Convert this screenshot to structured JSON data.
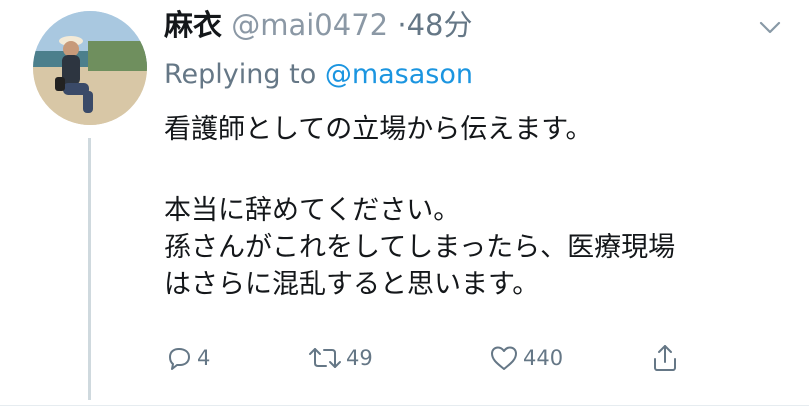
{
  "tweet": {
    "display_name": "麻衣",
    "handle": "@mai0472",
    "separator": "·",
    "time": "48分",
    "reply_prefix": "Replying to",
    "reply_to": "@masason",
    "lines": [
      "看護師としての立場から伝えます。",
      "本当に辞めてください。",
      "孫さんがこれをしてしまったら、医療現場",
      "はさらに混乱すると思います。"
    ]
  },
  "actions": {
    "reply_count": "4",
    "retweet_count": "49",
    "like_count": "440",
    "share_count": ""
  },
  "icons": {
    "avatar": "avatar-photo",
    "menu": "chevron-down-icon",
    "reply": "reply-icon",
    "retweet": "retweet-icon",
    "like": "heart-icon",
    "share": "share-icon"
  },
  "colors": {
    "text": "#14171a",
    "secondary": "#657786",
    "link": "#1b95e0",
    "thread_line": "#cfd9de"
  }
}
